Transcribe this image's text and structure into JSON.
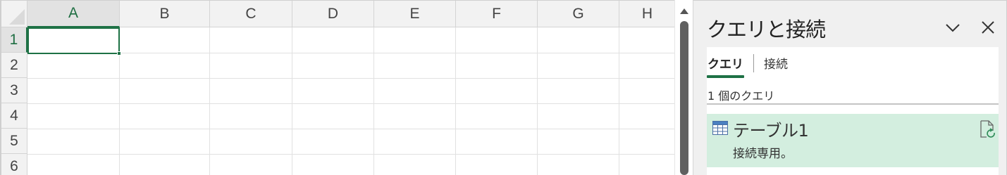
{
  "spreadsheet": {
    "columns": [
      "A",
      "B",
      "C",
      "D",
      "E",
      "F",
      "G",
      "H"
    ],
    "rows": [
      "1",
      "2",
      "3",
      "4",
      "5",
      "6"
    ],
    "selected_column": "A",
    "selected_row": "1",
    "active_cell": "A1",
    "accent_color": "#1e7145"
  },
  "query_pane": {
    "title": "クエリと接続",
    "collapse_icon": "chevron-down-icon",
    "close_icon": "close-icon",
    "tabs": [
      {
        "label": "クエリ",
        "selected": true
      },
      {
        "label": "接続",
        "selected": false
      }
    ],
    "count_label": "1 個のクエリ",
    "queries": [
      {
        "name": "テーブル1",
        "description": "接続専用。",
        "icon": "table-icon",
        "action_icon": "refresh-icon",
        "highlight_color": "#d3eedf"
      }
    ]
  }
}
